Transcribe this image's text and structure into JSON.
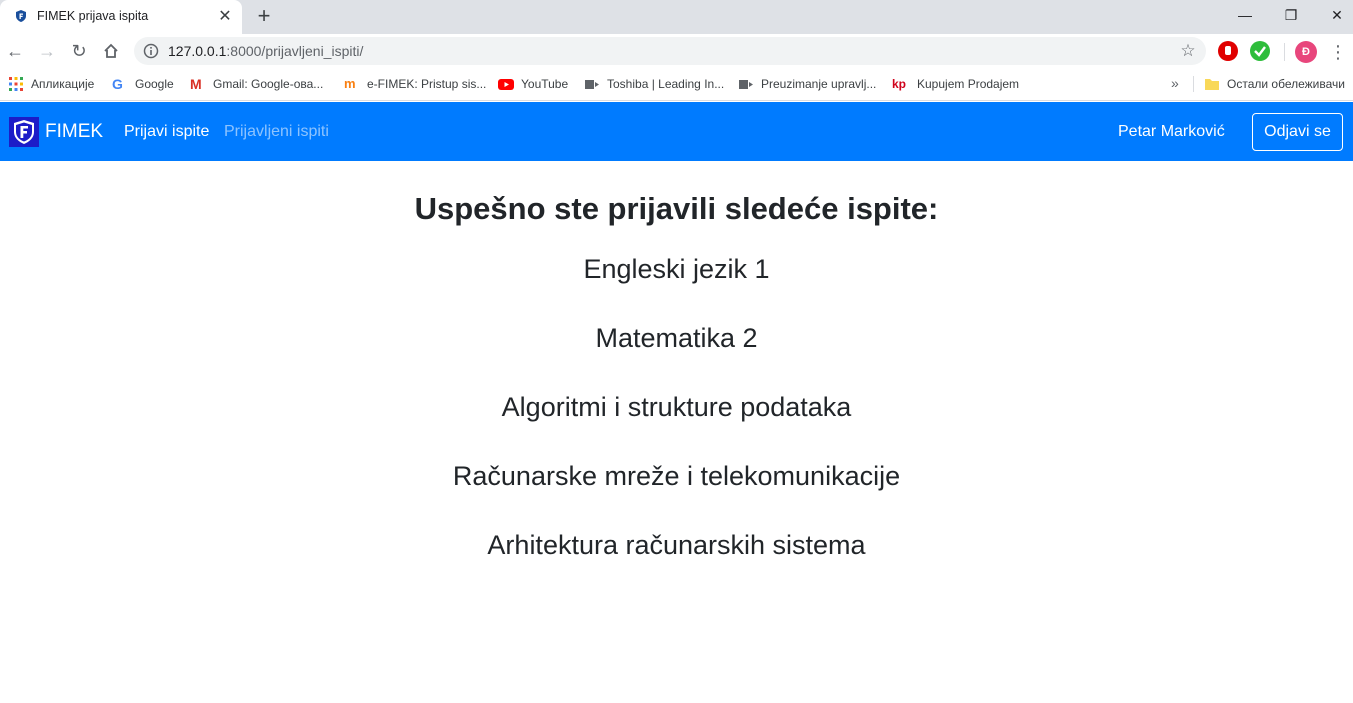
{
  "browser": {
    "tab_title": "FIMEK prijava ispita",
    "url_host": "127.0.0.1",
    "url_path": ":8000/prijavljeni_ispiti/",
    "profile_initial": "Đ",
    "bookmarks": [
      {
        "label": "Апликације",
        "icon": "apps-grid-icon"
      },
      {
        "label": "Google",
        "icon": "google-icon"
      },
      {
        "label": "Gmail: Google-ова...",
        "icon": "gmail-icon"
      },
      {
        "label": "e-FIMEK: Pristup sis...",
        "icon": "moodle-icon"
      },
      {
        "label": "YouTube",
        "icon": "youtube-icon"
      },
      {
        "label": "Toshiba | Leading In...",
        "icon": "bookmark-page-icon"
      },
      {
        "label": "Preuzimanje upravlj...",
        "icon": "bookmark-page-icon"
      },
      {
        "label": "Kupujem Prodajem",
        "icon": "kp-icon"
      }
    ],
    "other_bookmarks": "Остали обележивачи"
  },
  "navbar": {
    "brand": "FIMEK",
    "links": [
      {
        "label": "Prijavi ispite",
        "active": true
      },
      {
        "label": "Prijavljeni ispiti",
        "active": false
      }
    ],
    "user": "Petar Marković",
    "logout": "Odjavi se",
    "color": "#007bff"
  },
  "main": {
    "title": "Uspešno ste prijavili sledeće ispite:",
    "exams": [
      "Engleski jezik 1",
      "Matematika 2",
      "Algoritmi i strukture podataka",
      "Računarske mreže i telekomunikacije",
      "Arhitektura računarskih sistema"
    ]
  }
}
